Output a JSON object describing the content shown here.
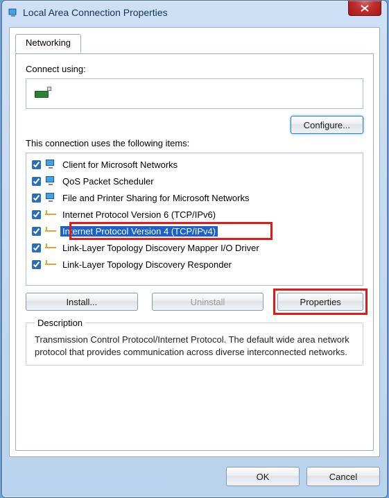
{
  "title": "Local Area Connection Properties",
  "tab_label": "Networking",
  "connect_label": "Connect using:",
  "adapter_name": "",
  "configure_label": "Configure...",
  "items_label": "This connection uses the following items:",
  "install_label": "Install...",
  "uninstall_label": "Uninstall",
  "properties_label": "Properties",
  "description_legend": "Description",
  "description_text": "Transmission Control Protocol/Internet Protocol. The default wide area network protocol that provides communication across diverse interconnected networks.",
  "ok_label": "OK",
  "cancel_label": "Cancel",
  "items": [
    {
      "label": "Client for Microsoft Networks",
      "icon": "monitor"
    },
    {
      "label": "QoS Packet Scheduler",
      "icon": "monitor"
    },
    {
      "label": "File and Printer Sharing for Microsoft Networks",
      "icon": "monitor"
    },
    {
      "label": "Internet Protocol Version 6 (TCP/IPv6)",
      "icon": "net"
    },
    {
      "label": "Internet Protocol Version 4 (TCP/IPv4)",
      "icon": "net"
    },
    {
      "label": "Link-Layer Topology Discovery Mapper I/O Driver",
      "icon": "net"
    },
    {
      "label": "Link-Layer Topology Discovery Responder",
      "icon": "net"
    }
  ]
}
